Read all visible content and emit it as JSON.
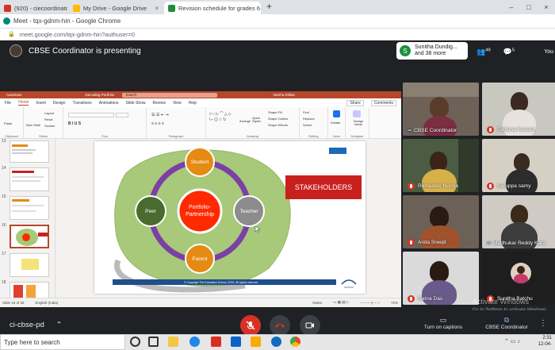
{
  "browser": {
    "tabs": [
      {
        "label": "(920) - ciecoordinator@i",
        "close": "×"
      },
      {
        "label": "My Drive - Google Drive",
        "close": "×"
      },
      {
        "label": "Revision schedule for grades 6-",
        "close": "×"
      }
    ],
    "new_tab": "+",
    "window_title": "Meet - tqx-gdnm-hin - Google Chrome",
    "url": "meet.google.com/tqx-gdnm-hin?authuser=0",
    "win_controls": [
      "–",
      "□",
      "×"
    ]
  },
  "meet": {
    "presenting_label": "CBSE Coordinator is presenting",
    "joined_name": "Sunitha Dundig...",
    "joined_more": "and 38 more",
    "joined_initial": "S",
    "participant_count": "49",
    "chat_count": "5",
    "self_label": "You",
    "meeting_code": "ci-cbse-pd",
    "captions_label": "Turn on captions",
    "presenter_label": "CBSE Coordinator",
    "colors": {
      "end_call": "#d93025",
      "mic_off": "#d93025",
      "accent": "#1e8e3e"
    }
  },
  "participants": [
    {
      "name": "CBSE Coordinator",
      "muted": false,
      "bg": "#6e6258"
    },
    {
      "name": "Fathima Kaneez",
      "muted": true,
      "bg": "#c8c8c0"
    },
    {
      "name": "Ramadevi Nunna",
      "muted": true,
      "bg": "#4b5c42"
    },
    {
      "name": "Karuppa samy",
      "muted": true,
      "bg": "#d6d0c4"
    },
    {
      "name": "Anita Sreejit",
      "muted": true,
      "bg": "#6b6156"
    },
    {
      "name": "Madhukar Reddy Kara",
      "muted": false,
      "bg": "#cfcac4"
    },
    {
      "name": "Ratna Das",
      "muted": true,
      "bg": "#dadada"
    },
    {
      "name": "Sunitha Batchu",
      "muted": true,
      "bg": "#1e1e1e"
    }
  ],
  "ppt": {
    "autosave": "AutoSave",
    "doc_title": "Decoding Portfolio",
    "search_placeholder": "Search",
    "user": "Varsha Dilikar",
    "menu": [
      "File",
      "Home",
      "Insert",
      "Design",
      "Transitions",
      "Animations",
      "Slide Show",
      "Review",
      "View",
      "Help"
    ],
    "share": "Share",
    "comments": "Comments",
    "ribbon_groups": [
      "Clipboard",
      "Slides",
      "Font",
      "Paragraph",
      "Drawing",
      "Editing",
      "Voice",
      "Designer"
    ],
    "ribbon_buttons": {
      "paste": "Paste",
      "new_slide": "New Slide",
      "layout": "Layout",
      "reset": "Reset",
      "section": "Section",
      "arrange": "Arrange",
      "quick_styles": "Quick Styles",
      "shape_fill": "Shape Fill",
      "shape_outline": "Shape Outline",
      "shape_effects": "Shape Effects",
      "find": "Find",
      "replace": "Replace",
      "select": "Select",
      "dictate": "Dictate",
      "design_ideas": "Design Ideas"
    },
    "thumbs": [
      "13",
      "14",
      "15",
      "16",
      "17",
      "18"
    ],
    "status_slide": "Slide 16 of 28",
    "status_lang": "English (India)",
    "status_notes": "Notes",
    "zoom": "72%"
  },
  "slide": {
    "center": "Portfolio-Partnership",
    "nodes": {
      "top": "Student",
      "left": "Peer",
      "right": "Teacher",
      "bottom": "Parent"
    },
    "stakeholders": "STAKEHOLDERS",
    "footer": "© Copyright The Education School, 2024. All rights reserved.",
    "logo_text": "ZODIUM",
    "colors": {
      "blob": "#a8c87a",
      "ring": "#7b3fa5",
      "center": "#ff2a00",
      "node": "#e58a12",
      "peer": "#4a6b2e",
      "teacher": "#8c8c8c",
      "label_bg": "#c8201e"
    }
  },
  "windows": {
    "activate_title": "Activate Windows",
    "activate_sub": "Go to Settings to activate Windows."
  },
  "taskbar": {
    "search": "Type here to search",
    "time": "2:31",
    "date": "12-04-"
  }
}
